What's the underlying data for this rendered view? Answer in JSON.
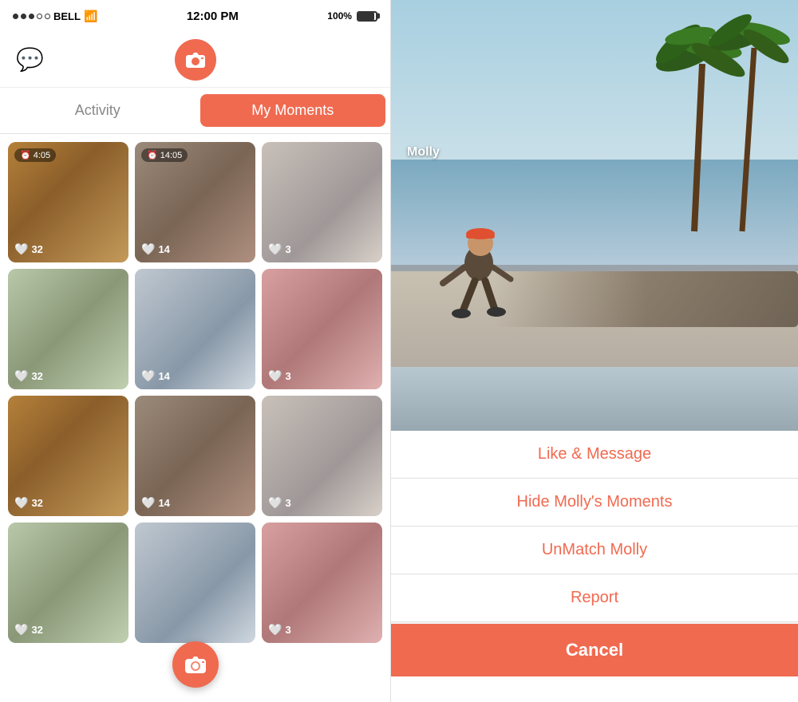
{
  "statusBar": {
    "carrier": "BELL",
    "time": "12:00 PM",
    "battery": "100%"
  },
  "header": {
    "cameraIcon": "📷"
  },
  "tabs": {
    "activity": "Activity",
    "myMoments": "My Moments"
  },
  "moments": [
    {
      "id": 1,
      "timer": "4:05",
      "likes": 32,
      "cardClass": "card-wood"
    },
    {
      "id": 2,
      "timer": "14:05",
      "likes": 14,
      "cardClass": "card-grid"
    },
    {
      "id": 3,
      "timer": "",
      "likes": 3,
      "cardClass": "card-building"
    },
    {
      "id": 4,
      "timer": "",
      "likes": 32,
      "cardClass": "card-trees"
    },
    {
      "id": 5,
      "timer": "",
      "likes": 14,
      "cardClass": "card-arch"
    },
    {
      "id": 6,
      "timer": "",
      "likes": 3,
      "cardClass": "card-pink"
    },
    {
      "id": 7,
      "timer": "",
      "likes": 32,
      "cardClass": "card-wood"
    },
    {
      "id": 8,
      "timer": "",
      "likes": 14,
      "cardClass": "card-grid"
    },
    {
      "id": 9,
      "timer": "",
      "likes": 3,
      "cardClass": "card-building"
    },
    {
      "id": 10,
      "timer": "",
      "likes": 32,
      "cardClass": "card-trees"
    },
    {
      "id": 11,
      "timer": "",
      "likes": "",
      "cardClass": "card-arch"
    },
    {
      "id": 12,
      "timer": "",
      "likes": 3,
      "cardClass": "card-pink"
    }
  ],
  "fab": "📷",
  "rightPanel": {
    "userName": "Molly",
    "photo": "beach-skate-scene"
  },
  "actionSheet": {
    "items": [
      "Like & Message",
      "Hide Molly's Moments",
      "UnMatch Molly",
      "Report"
    ],
    "cancel": "Cancel"
  }
}
